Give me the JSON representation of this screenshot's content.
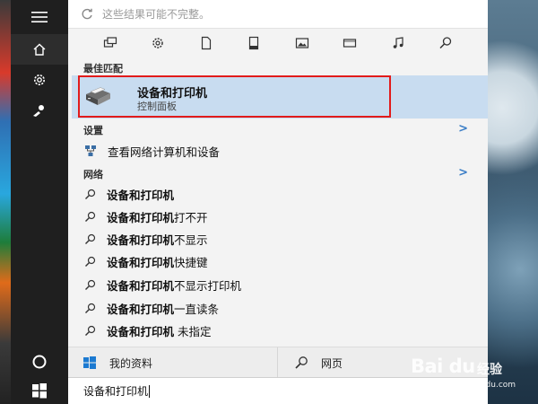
{
  "search_header": {
    "message": "这些结果可能不完整。"
  },
  "filters": [
    {
      "name": "apps-filter-icon"
    },
    {
      "name": "settings-filter-icon"
    },
    {
      "name": "documents-filter-icon"
    },
    {
      "name": "folders-filter-icon"
    },
    {
      "name": "photos-filter-icon"
    },
    {
      "name": "videos-filter-icon"
    },
    {
      "name": "music-filter-icon"
    },
    {
      "name": "web-search-filter-icon"
    }
  ],
  "best_match": {
    "heading": "最佳匹配",
    "title": "设备和打印机",
    "subtitle": "控制面板",
    "icon": "printer-icon",
    "highlight_color": "#e21b1b"
  },
  "settings_section": {
    "heading": "设置",
    "item": "查看网络计算机和设备"
  },
  "web_section": {
    "heading": "网络",
    "suggestions": [
      {
        "bold": "设备和打印机",
        "rest": ""
      },
      {
        "bold": "设备和打印机",
        "rest": "打不开"
      },
      {
        "bold": "设备和打印机",
        "rest": "不显示"
      },
      {
        "bold": "设备和打印机",
        "rest": "快捷键"
      },
      {
        "bold": "设备和打印机",
        "rest": "不显示打印机"
      },
      {
        "bold": "设备和打印机",
        "rest": "一直读条"
      },
      {
        "bold": "设备和打印机",
        "rest": " 未指定"
      }
    ]
  },
  "bottom_bar": {
    "my_stuff": "我的资料",
    "web": "网页"
  },
  "search_box": {
    "value": "设备和打印机"
  },
  "watermark": {
    "logo": "Bai du",
    "text": "经验",
    "url": "jingyan.baidu.com"
  },
  "colors": {
    "accent": "#3b7ec6",
    "selected_bg": "#c8dcf0",
    "sidebar": "#1f1f1f"
  }
}
